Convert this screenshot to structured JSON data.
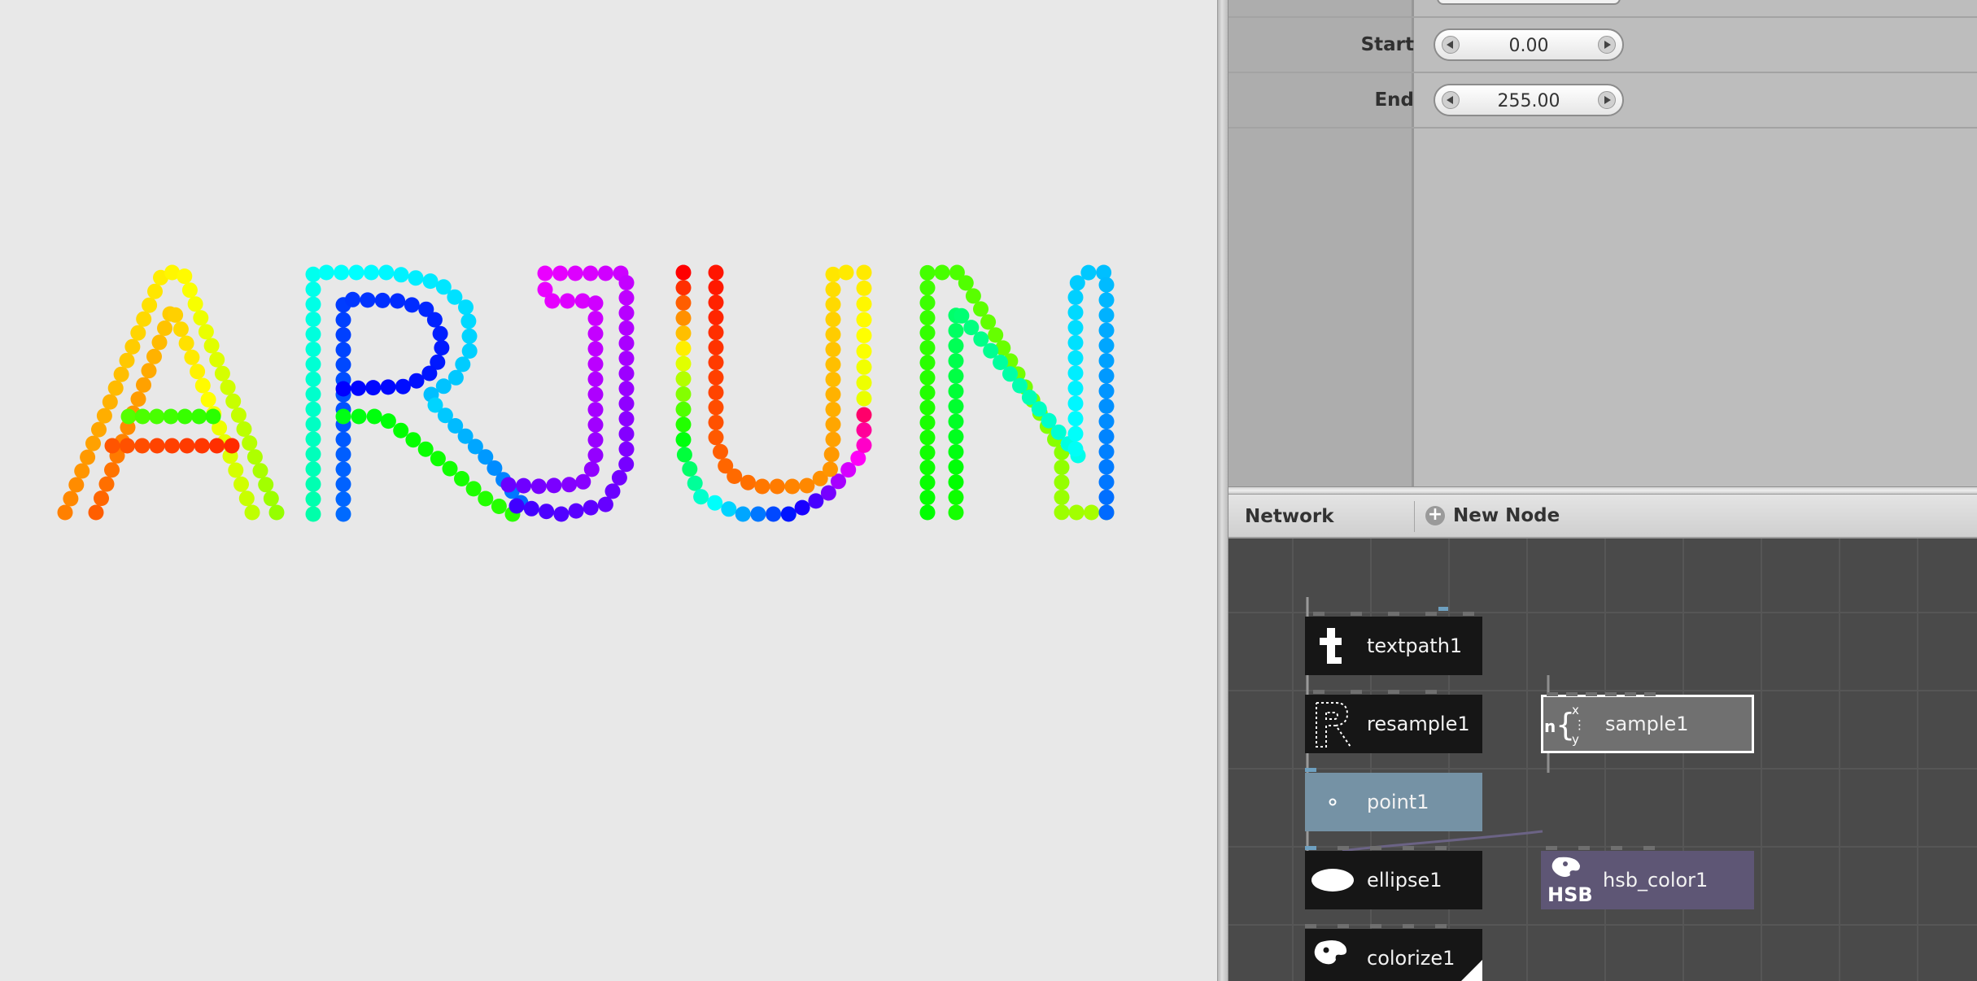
{
  "viewer": {
    "text": "ARJUN"
  },
  "parameters": {
    "rows": [
      {
        "label": "Start",
        "value": "0.00"
      },
      {
        "label": "End",
        "value": "255.00"
      }
    ]
  },
  "network": {
    "tab_label": "Network",
    "new_node_label": "New Node",
    "nodes": [
      {
        "label": "textpath1",
        "icon": "textpath-icon"
      },
      {
        "label": "resample1",
        "icon": "resample-icon"
      },
      {
        "label": "sample1",
        "icon": "sample-icon"
      },
      {
        "label": "point1",
        "icon": "point-icon",
        "rendered": true
      },
      {
        "label": "ellipse1",
        "icon": "ellipse-icon"
      },
      {
        "label": "hsb_color1",
        "icon": "hsb-color-icon",
        "icon_text": "HSB"
      },
      {
        "label": "colorize1",
        "icon": "colorize-icon"
      }
    ]
  },
  "colors": {
    "viewer_bg": "#e8e8e8",
    "node_dark": "#161616",
    "node_rendered": "#7592a5",
    "node_sample": "#707070",
    "node_hsb": "#5e5675",
    "network_bg": "#4a4a4a"
  }
}
